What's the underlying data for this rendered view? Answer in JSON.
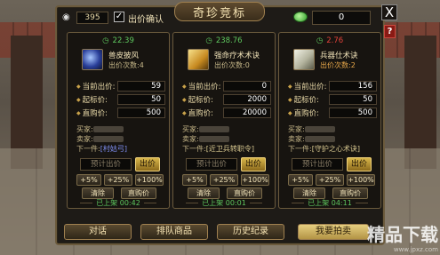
{
  "title": "奇珍竞标",
  "topbar": {
    "watch_count": "395",
    "bid_confirm_checked": "✓",
    "bid_confirm_label": "出价确认",
    "currency_value": "0",
    "close": "X",
    "help": "?"
  },
  "colors": {
    "timer_green": "#5ec75e",
    "timer_red": "#e2423a",
    "next_item_blue": "#7e8ef0",
    "accent_gold": "#d8b64a"
  },
  "columns": [
    {
      "timer": "22.39",
      "timer_color": "green",
      "item_icon": "blue-cloak-icon",
      "item_name": "兽皮披风",
      "stock": "出价次数:4",
      "current_bid_label": "当前出价:",
      "current_bid": "59",
      "start_bid_label": "起标价:",
      "start_bid": "50",
      "buyout_label": "直购价:",
      "buyout": "500",
      "buyer_label": "买家:",
      "seller_label": "卖家:",
      "next_label": "下一件:",
      "next_item": "[村姑弓]",
      "bid_placeholder": "预计出价",
      "bid_button": "出价",
      "plus5": "+5%",
      "plus25": "+25%",
      "plus100": "+100%",
      "clear": "清除",
      "buy_now": "直购价",
      "listed": "已上架 00:42"
    },
    {
      "timer": "238.76",
      "timer_color": "green",
      "item_icon": "gold-book-icon",
      "item_name": "强命疗术术诀",
      "stock": "出价次数:0",
      "current_bid_label": "当前出价:",
      "current_bid": "0",
      "start_bid_label": "起标价:",
      "start_bid": "2000",
      "buyout_label": "直购价:",
      "buyout": "20000",
      "buyer_label": "买家:",
      "seller_label": "卖家:",
      "next_label": "下一件:",
      "next_item": "[近卫兵转职令]",
      "bid_placeholder": "预计出价",
      "bid_button": "出价",
      "plus5": "+5%",
      "plus25": "+25%",
      "plus100": "+100%",
      "clear": "清除",
      "buy_now": "直购价",
      "listed": "已上架 00:01"
    },
    {
      "timer": "2.76",
      "timer_color": "red",
      "item_icon": "silver-book-icon",
      "item_name": "兵器仕术诀",
      "stock": "出价次数:2",
      "current_bid_label": "当前出价:",
      "current_bid": "156",
      "start_bid_label": "起标价:",
      "start_bid": "50",
      "buyout_label": "直购价:",
      "buyout": "500",
      "buyer_label": "买家:",
      "seller_label": "卖家:",
      "next_label": "下一件:",
      "next_item": "[守护之心术诀]",
      "bid_placeholder": "预计出价",
      "bid_button": "出价",
      "plus5": "+5%",
      "plus25": "+25%",
      "plus100": "+100%",
      "clear": "清除",
      "buy_now": "直购价",
      "listed": "已上架 04:11"
    }
  ],
  "tabs": [
    "对话",
    "排队商品",
    "历史纪录",
    "我要拍卖"
  ],
  "watermark": {
    "text": "精品下载",
    "sub": "www.jpxz.com"
  }
}
